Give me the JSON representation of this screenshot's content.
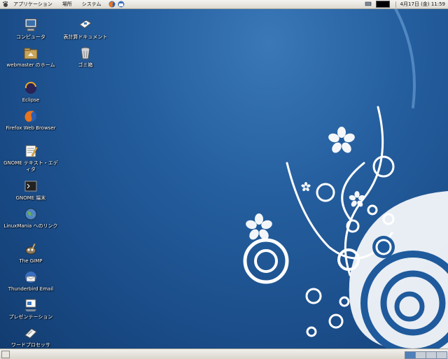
{
  "top_panel": {
    "applications": "アプリケーション",
    "places": "場所",
    "system": "システム",
    "clock": "4月17日 (金) 11:59"
  },
  "desktop_icons": [
    {
      "label": "コンピュータ",
      "icon": "computer-icon"
    },
    {
      "label": "webmaster のホーム",
      "icon": "home-folder-icon"
    },
    {
      "label": "Eclipse",
      "icon": "eclipse-icon"
    },
    {
      "label": "Firefox Web Browser",
      "icon": "firefox-icon"
    },
    {
      "label": "GNOME テキスト・エディタ",
      "icon": "text-editor-icon"
    },
    {
      "label": "GNOME 端末",
      "icon": "terminal-icon"
    },
    {
      "label": "LinuxMania へのリンク",
      "icon": "globe-link-icon"
    },
    {
      "label": "The GIMP",
      "icon": "gimp-icon"
    },
    {
      "label": "Thunderbird Email",
      "icon": "thunderbird-icon"
    },
    {
      "label": "プレゼンテーション",
      "icon": "presentation-icon"
    },
    {
      "label": "ワードプロセッサ",
      "icon": "word-processor-icon"
    },
    {
      "label": "表計算ドキュメント",
      "icon": "spreadsheet-icon"
    },
    {
      "label": "ゴミ箱",
      "icon": "trash-icon"
    }
  ],
  "colors": {
    "desktop_bg": "#1c4f8c",
    "panel_bg": "#e9e7e0",
    "workspace_active": "#4f7fb8",
    "workspace_inactive": "#c7ced8"
  }
}
